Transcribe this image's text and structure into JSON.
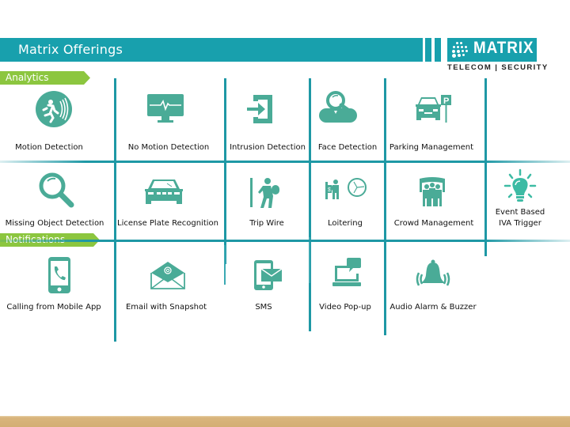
{
  "header": {
    "title": "Matrix Offerings",
    "logo": {
      "name": "MATRIX",
      "tagline": "TELECOM | SECURITY"
    }
  },
  "colors": {
    "teal": "#18a0ad",
    "icon": "#4aab97",
    "green": "#8cc63f",
    "footer": "#d4ae74"
  },
  "sections": {
    "analytics": {
      "label": "Analytics",
      "items": [
        {
          "label": "Motion Detection",
          "icon": "running-man-motion-icon"
        },
        {
          "label": "No Motion Detection",
          "icon": "monitor-heartbeat-icon"
        },
        {
          "label": "Intrusion Detection",
          "icon": "enter-door-icon"
        },
        {
          "label": "Face Detection",
          "icon": "person-magnifier-icon"
        },
        {
          "label": "Parking Management",
          "icon": "car-parking-icon"
        },
        {
          "label": "Missing  Object Detection",
          "icon": "magnifier-icon"
        },
        {
          "label": "License Plate Recognition",
          "icon": "car-front-icon"
        },
        {
          "label": "Trip Wire",
          "icon": "person-crossing-line-icon"
        },
        {
          "label": "Loitering",
          "icon": "person-clock-icon"
        },
        {
          "label": "Crowd Management",
          "icon": "crowd-icon"
        },
        {
          "label_line1": "Event Based",
          "label_line2": "IVA Trigger",
          "icon": "lightbulb-icon"
        }
      ]
    },
    "notifications": {
      "label": "Notifications",
      "items": [
        {
          "label": "Calling from Mobile App",
          "icon": "mobile-phone-call-icon"
        },
        {
          "label": "Email with Snapshot",
          "icon": "email-envelope-icon"
        },
        {
          "label": "SMS",
          "icon": "sms-phone-icon"
        },
        {
          "label": "Video Pop-up",
          "icon": "laptop-popup-icon"
        },
        {
          "label": "Audio Alarm &  Buzzer",
          "icon": "alarm-bell-icon"
        }
      ]
    }
  }
}
